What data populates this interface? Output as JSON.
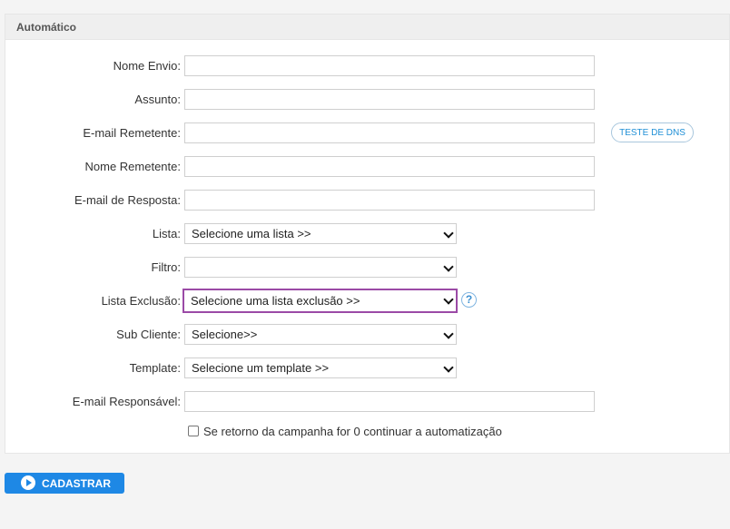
{
  "panel": {
    "title": "Automático"
  },
  "form": {
    "nome_envio": {
      "label": "Nome Envio:",
      "value": ""
    },
    "assunto": {
      "label": "Assunto:",
      "value": ""
    },
    "email_remetente": {
      "label": "E-mail Remetente:",
      "value": "",
      "dns_button": "TESTE DE DNS"
    },
    "nome_remetente": {
      "label": "Nome Remetente:",
      "value": ""
    },
    "email_resposta": {
      "label": "E-mail de Resposta:",
      "value": ""
    },
    "lista": {
      "label": "Lista:",
      "selected": "Selecione uma lista >>"
    },
    "filtro": {
      "label": "Filtro:",
      "selected": ""
    },
    "lista_exclusao": {
      "label": "Lista Exclusão:",
      "selected": "Selecione uma lista exclusão >>",
      "help": "?"
    },
    "sub_cliente": {
      "label": "Sub Cliente:",
      "selected": "Selecione>>"
    },
    "template": {
      "label": "Template:",
      "selected": "Selecione um template >>"
    },
    "email_responsavel": {
      "label": "E-mail Responsável:",
      "value": ""
    },
    "continuar_checkbox": {
      "label": "Se retorno da campanha for 0 continuar a automatização",
      "checked": false
    }
  },
  "actions": {
    "submit_label": "CADASTRAR"
  },
  "colors": {
    "accent": "#1e88e5",
    "highlight_border": "#9b4aa6"
  }
}
